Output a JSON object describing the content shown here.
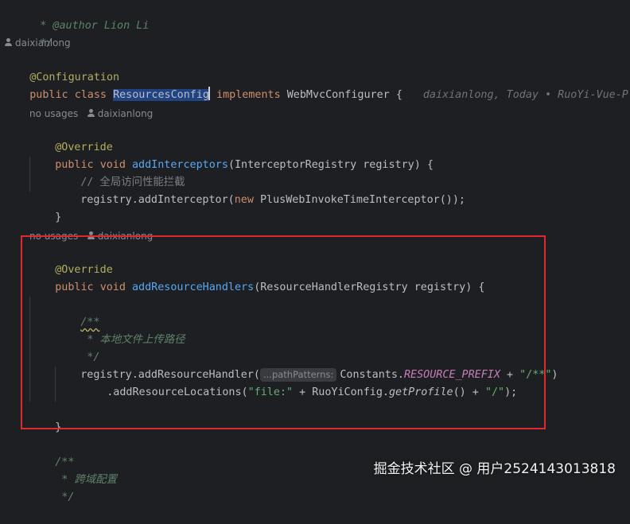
{
  "editor": {
    "header": {
      "author_line": " * @author Lion Li",
      "close_line": " */"
    },
    "class_blame_author": "daixianlong",
    "class_annotation": "@Configuration",
    "class_decl": {
      "kw_public": "public",
      "kw_class": "class",
      "class_name": "ResourcesConfig",
      "kw_implements": "implements",
      "interface_name": "WebMvcConfigurer",
      "brace": "{",
      "inline_blame": "daixianlong, Today • RuoYi-Vue-Plus文"
    },
    "method1": {
      "usages": "no usages",
      "author": "daixianlong",
      "annotation": "@Override",
      "kw_public": "public",
      "kw_void": "void",
      "name": "addInterceptors",
      "params": "(InterceptorRegistry registry) {",
      "comment": "// 全局访问性能拦截",
      "body_prefix": "registry.addInterceptor(",
      "kw_new": "new",
      "body_suffix": " PlusWebInvokeTimeInterceptor());",
      "close": "}"
    },
    "method2": {
      "usages": "no usages",
      "author": "daixianlong",
      "annotation": "@Override",
      "kw_public": "public",
      "kw_void": "void",
      "name": "addResourceHandlers",
      "params": "(ResourceHandlerRegistry registry) {",
      "doc_open": "/**",
      "doc_text": " * 本地文件上传路径",
      "doc_close": " */",
      "handler_prefix": "registry.addResourceHandler(",
      "param_hint": "...pathPatterns:",
      "handler_const_owner": "Constants.",
      "handler_const": "RESOURCE_PREFIX",
      "handler_plus": " + ",
      "handler_str": "\"/**\"",
      "handler_close": ")",
      "loc_prefix": ".addResourceLocations(",
      "loc_str1": "\"file:\"",
      "loc_plus1": " + RuoYiConfig.",
      "loc_method": "getProfile",
      "loc_plus2": "() + ",
      "loc_str2": "\"/\"",
      "loc_close": ");",
      "close": "}"
    },
    "tail": {
      "doc_open": "/**",
      "doc_text": " * 跨域配置",
      "doc_close": " */"
    }
  },
  "watermark": "掘金技术社区 @ 用户2524143013818",
  "colors": {
    "background": "#1e1f22",
    "keyword": "#cf8e6d",
    "annotation": "#b3ae60",
    "method": "#56a8f5",
    "string": "#6aab73",
    "constant": "#c77dbb",
    "doc_comment": "#5f826b",
    "selection": "#214283",
    "highlight_box": "#e0282e"
  }
}
